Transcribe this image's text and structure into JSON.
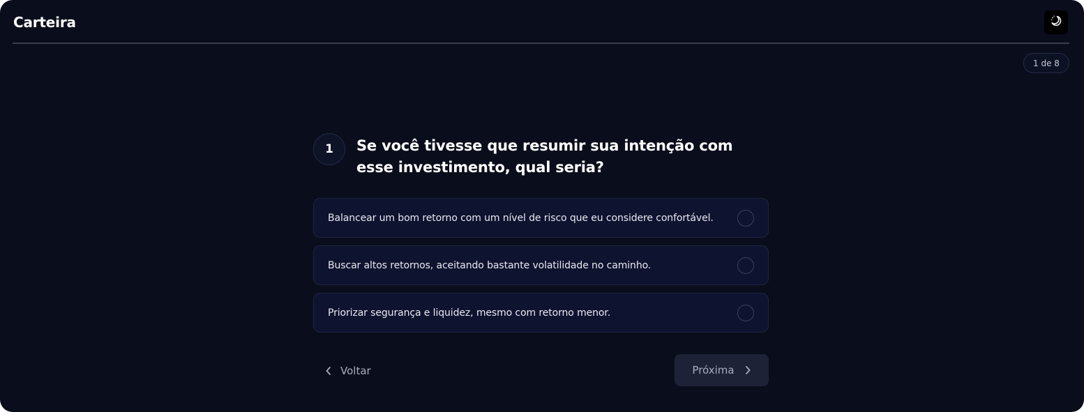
{
  "header": {
    "title": "Carteira",
    "theme_toggle_icon": "moon-icon"
  },
  "progress": {
    "label": "1 de 8",
    "current": 1,
    "total": 8
  },
  "question": {
    "number": "1",
    "text": "Se você tivesse que resumir sua intenção com esse investimento, qual seria?"
  },
  "options": [
    {
      "label": "Balancear um bom retorno com um nível de risco que eu considere confortável.",
      "selected": false
    },
    {
      "label": "Buscar altos retornos, aceitando bastante volatilidade no caminho.",
      "selected": false
    },
    {
      "label": "Priorizar segurança e liquidez, mesmo com retorno menor.",
      "selected": false
    }
  ],
  "navigation": {
    "back_label": "Voltar",
    "back_icon": "chevron-left-icon",
    "next_label": "Próxima",
    "next_icon": "chevron-right-icon"
  },
  "colors": {
    "background": "#0a0d1b",
    "option_background": "#0e1330",
    "next_button_background": "#1d2236",
    "text_primary": "#ffffff",
    "text_muted": "#a9adbd"
  }
}
